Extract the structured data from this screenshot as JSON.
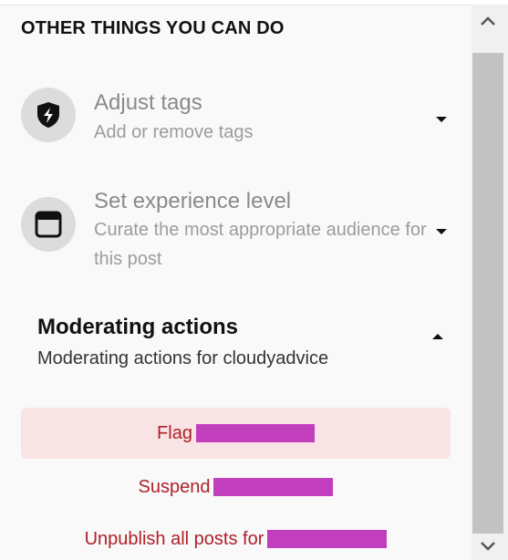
{
  "section": {
    "heading": "OTHER THINGS YOU CAN DO"
  },
  "options": [
    {
      "title": "Adjust tags",
      "description": "Add or remove tags",
      "icon": "shield-bolt-icon"
    },
    {
      "title": "Set experience level",
      "description": "Curate the most appropriate audience for this post",
      "icon": "browser-window-icon"
    }
  ],
  "moderating": {
    "title": "Moderating actions",
    "description": "Moderating actions for cloudyadvice"
  },
  "actions": [
    {
      "label": "Flag"
    },
    {
      "label": "Suspend"
    },
    {
      "label": "Unpublish all posts for"
    }
  ],
  "colors": {
    "action_text": "#b0202a",
    "highlight_bg": "#f8e4e4",
    "redaction": "#c13fbd",
    "scroll_thumb": "#c2c2c2"
  }
}
